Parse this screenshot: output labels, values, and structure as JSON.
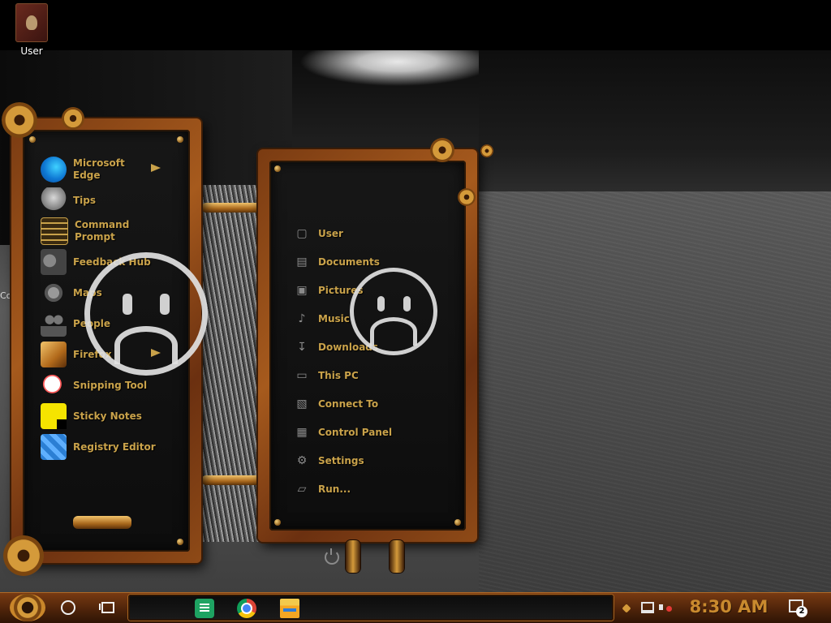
{
  "desktop": {
    "user_icon_label": "User",
    "left_edge_text": "Co"
  },
  "start_left": {
    "apps": [
      {
        "label": "Microsoft\nEdge",
        "icon": "edge-icon",
        "has_submenu": true
      },
      {
        "label": "Tips",
        "icon": "tips-icon",
        "has_submenu": false
      },
      {
        "label": "Command\nPrompt",
        "icon": "command-prompt-icon",
        "has_submenu": false
      },
      {
        "label": "Feedback Hub",
        "icon": "feedback-hub-icon",
        "has_submenu": false
      },
      {
        "label": "Maps",
        "icon": "maps-icon",
        "has_submenu": false
      },
      {
        "label": "People",
        "icon": "people-icon",
        "has_submenu": false
      },
      {
        "label": "Firefox",
        "icon": "firefox-icon",
        "has_submenu": true
      },
      {
        "label": "Snipping Tool",
        "icon": "snipping-tool-icon",
        "has_submenu": false
      },
      {
        "label": "Sticky Notes",
        "icon": "sticky-notes-icon",
        "has_submenu": false
      },
      {
        "label": "Registry Editor",
        "icon": "registry-editor-icon",
        "has_submenu": false
      }
    ]
  },
  "start_right": {
    "places": [
      {
        "label": "User",
        "icon": "user-icon"
      },
      {
        "label": "Documents",
        "icon": "documents-icon"
      },
      {
        "label": "Pictures",
        "icon": "pictures-icon"
      },
      {
        "label": "Music",
        "icon": "music-icon"
      },
      {
        "label": "Downloads",
        "icon": "downloads-icon"
      },
      {
        "label": "This PC",
        "icon": "this-pc-icon"
      },
      {
        "label": "Connect To",
        "icon": "connect-to-icon"
      },
      {
        "label": "Control Panel",
        "icon": "control-panel-icon"
      },
      {
        "label": "Settings",
        "icon": "settings-gear-icon"
      },
      {
        "label": "Run...",
        "icon": "run-icon"
      }
    ]
  },
  "taskbar": {
    "clock": "8:30 AM",
    "notification_count": "2",
    "pinned": [
      "sheets-icon",
      "chrome-icon",
      "file-explorer-icon"
    ]
  },
  "colors": {
    "accent_text": "#c9a24a",
    "frame_copper": "#a65a1d",
    "clock": "#c98a2e"
  }
}
